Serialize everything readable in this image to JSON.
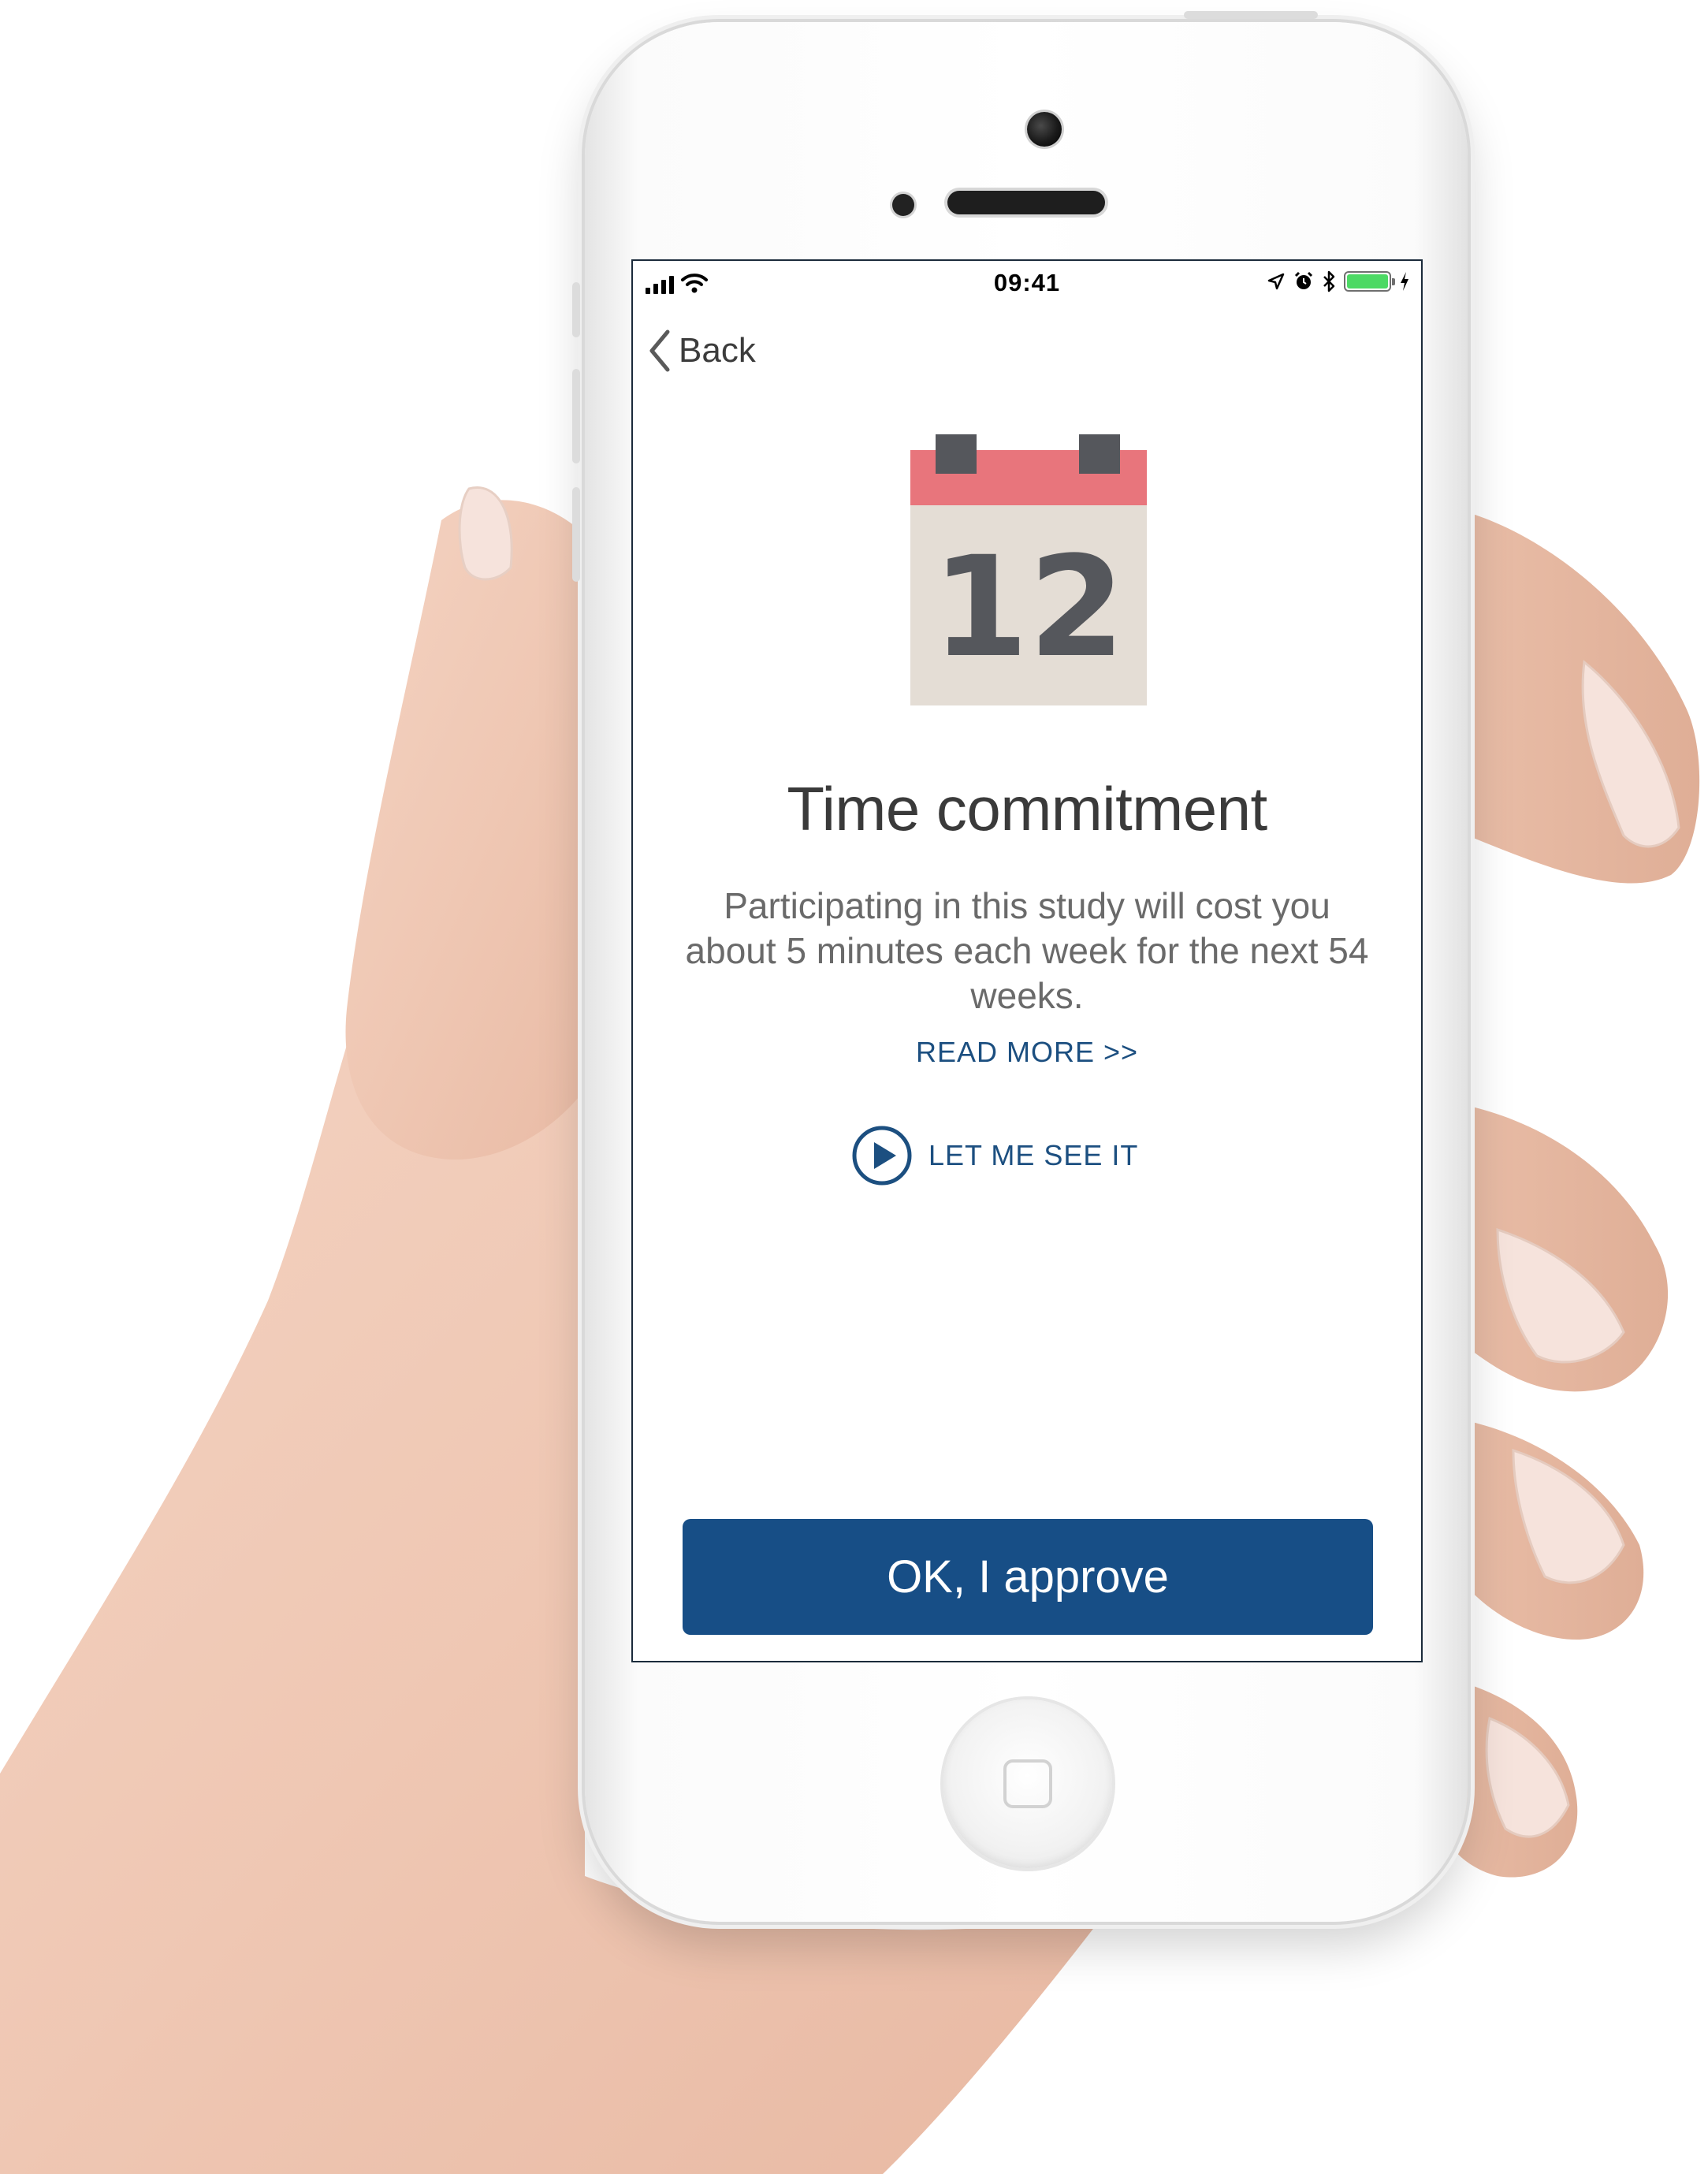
{
  "status_bar": {
    "time": "09:41",
    "battery_level": 1.0,
    "icons": [
      "signal-icon",
      "wifi-icon",
      "location-icon",
      "alarm-icon",
      "bluetooth-icon",
      "battery-icon",
      "charging-icon"
    ]
  },
  "nav": {
    "back_label": "Back",
    "back_icon": "chevron-left-icon"
  },
  "hero": {
    "icon": "calendar-icon",
    "calendar_number": "12",
    "colors": {
      "header": "#e8757c",
      "rings": "#55575c",
      "page": "#e4ddd5",
      "number": "#55575c"
    }
  },
  "content": {
    "title": "Time commitment",
    "body": "Participating in this study will cost you about 5 minutes each week for the next 54 weeks.",
    "read_more": "READ MORE >>",
    "video_label": "LET ME SEE IT",
    "video_icon": "play-circle-icon"
  },
  "actions": {
    "approve_label": "OK, I approve"
  },
  "colors": {
    "accent": "#1c4f80",
    "button": "#174e86",
    "text_dark": "#3a3a3a",
    "text_body": "#6a6a6a"
  }
}
